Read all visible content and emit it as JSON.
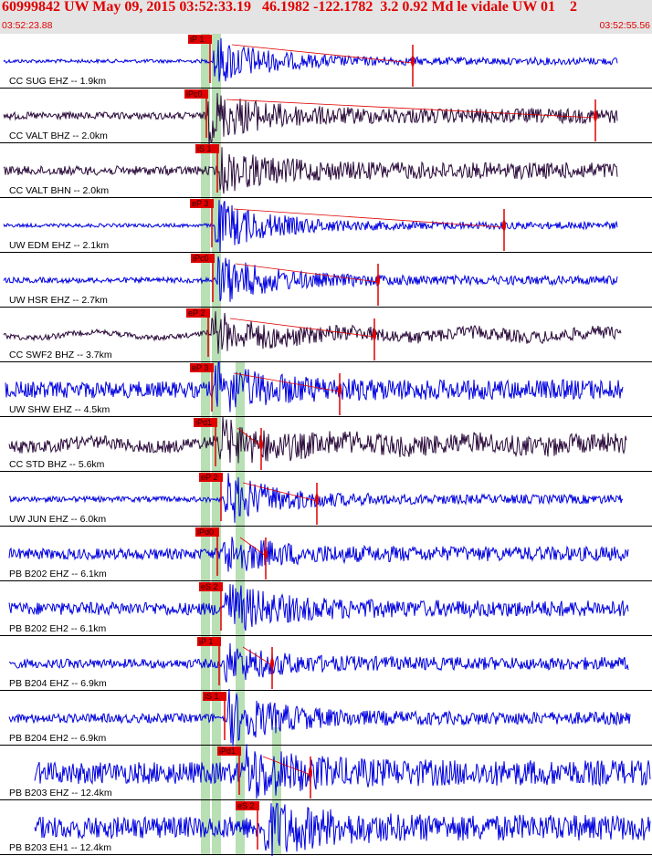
{
  "header": {
    "title": "60999842 UW May 09, 2015 03:52:33.19   46.1982 -122.1782  3.2 0.92 Md le vidale UW 01    2",
    "start_time": "03:52:23.88",
    "end_time": "03:52:55.56"
  },
  "colors": {
    "header_bg": "#e4e4e4",
    "title": "#e00000",
    "trace_blue": "#0000e0",
    "trace_dark": "#2a0a3a",
    "pick": "#e00000",
    "window_band": "#b9dfb4"
  },
  "traces": [
    {
      "label": "CC SUG EHZ -- 1.9km",
      "pick": "iP 1",
      "color": "blue"
    },
    {
      "label": "CC VALT BHZ -- 2.0km",
      "pick": "iPc0",
      "color": "dark"
    },
    {
      "label": "CC VALT BHN -- 2.0km",
      "pick": "iS 1",
      "color": "dark"
    },
    {
      "label": "UW EDM EHZ -- 2.1km",
      "pick": "eP 3",
      "color": "blue"
    },
    {
      "label": "UW HSR EHZ -- 2.7km",
      "pick": "iPc0",
      "color": "blue"
    },
    {
      "label": "CC SWF2 BHZ -- 3.7km",
      "pick": "eP 2",
      "color": "dark"
    },
    {
      "label": "UW SHW EHZ -- 4.5km",
      "pick": "eP 3",
      "color": "blue"
    },
    {
      "label": "CC STD BHZ -- 5.6km",
      "pick": "iPd1",
      "color": "dark"
    },
    {
      "label": "UW JUN EHZ -- 6.0km",
      "pick": "eP 2",
      "color": "blue"
    },
    {
      "label": "PB B202 EHZ -- 6.1km",
      "pick": "iPd0",
      "color": "blue"
    },
    {
      "label": "PB B202 EH2 -- 6.1km",
      "pick": "eS 2",
      "color": "blue"
    },
    {
      "label": "PB B204 EHZ -- 6.9km",
      "pick": "iP 1",
      "color": "blue"
    },
    {
      "label": "PB B204 EH2 -- 6.9km",
      "pick": "iS 1",
      "color": "blue"
    },
    {
      "label": "PB B203 EHZ -- 12.4km",
      "pick": "iPd1",
      "color": "blue"
    },
    {
      "label": "PB B203 EH1 -- 12.4km",
      "pick": "eS 2",
      "color": "blue"
    }
  ]
}
